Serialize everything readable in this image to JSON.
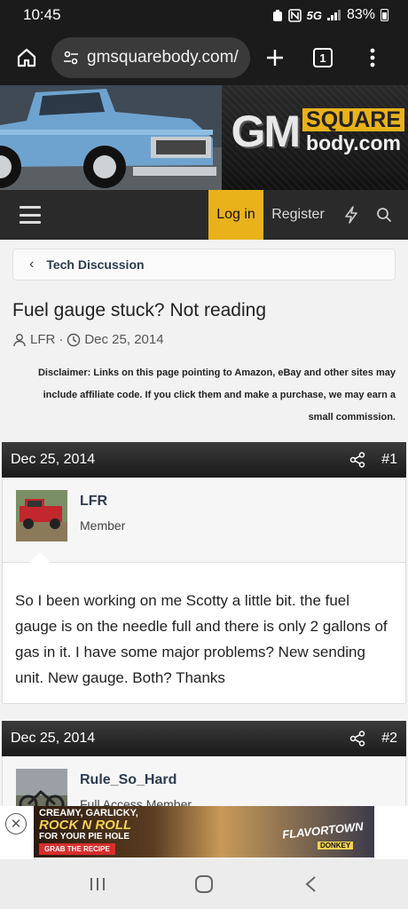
{
  "status": {
    "time": "10:45",
    "network": "5G",
    "battery": "83%"
  },
  "browser": {
    "url": "gmsquarebody.com/",
    "tab_count": "1"
  },
  "logo": {
    "gm": "GM",
    "square": "SQUARE",
    "body": "body.com"
  },
  "nav": {
    "login": "Log in",
    "register": "Register"
  },
  "breadcrumb": {
    "label": "Tech Discussion"
  },
  "thread": {
    "title": "Fuel gauge stuck? Not reading",
    "author": "LFR",
    "date": "Dec 25, 2014",
    "separator": "·"
  },
  "disclaimer": {
    "line1": "Disclaimer: Links on this page pointing to Amazon, eBay and other sites may",
    "line2": "include affiliate code. If you click them and make a purchase, we may earn a",
    "line3": "small commission."
  },
  "posts": [
    {
      "date": "Dec 25, 2014",
      "number": "#1",
      "username": "LFR",
      "user_title": "Member",
      "body": "So I been working on me Scotty a little bit. the fuel gauge is on the needle full and there is only 2 gallons of gas in it. I have some major problems? New sending unit. New gauge. Both? Thanks"
    },
    {
      "date": "Dec 25, 2014",
      "number": "#2",
      "username": "Rule_So_Hard",
      "user_title": "Full Access Member"
    }
  ],
  "ad": {
    "line1": "CREAMY, GARLICKY,",
    "line2": "ROCK N ROLL",
    "line3": "FOR YOUR PIE HOLE",
    "cta": "GRAB THE RECIPE",
    "brand": "FLAVORTOWN",
    "brand2": "DONKEY"
  },
  "colors": {
    "accent": "#e9b21b",
    "header_dark": "#1b1b1b",
    "link": "#2d3b4e"
  }
}
